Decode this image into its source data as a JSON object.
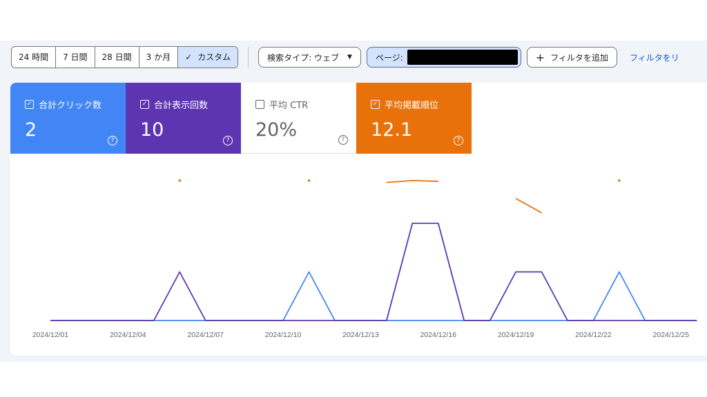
{
  "toolbar": {
    "ranges": [
      "24 時間",
      "7 日間",
      "28 日間",
      "3 か月",
      "カスタム"
    ],
    "active_range": "カスタム",
    "check_glyph": "✓",
    "search_type": "検索タイプ: ウェブ",
    "page_filter_label": "ページ:",
    "add_filter": "フィルタを追加",
    "reset_link": "フィルタをリ"
  },
  "metrics": [
    {
      "label": "合計クリック数",
      "value": "2",
      "checked": true,
      "color": "#4285f4"
    },
    {
      "label": "合計表示回数",
      "value": "10",
      "checked": true,
      "color": "#5e35b1"
    },
    {
      "label": "平均 CTR",
      "value": "20%",
      "checked": false,
      "color": "#5f6368"
    },
    {
      "label": "平均掲載順位",
      "value": "12.1",
      "checked": true,
      "color": "#e8710a"
    }
  ],
  "chart_data": {
    "type": "line",
    "x": [
      "2024/12/01",
      "2024/12/02",
      "2024/12/03",
      "2024/12/04",
      "2024/12/05",
      "2024/12/06",
      "2024/12/07",
      "2024/12/08",
      "2024/12/09",
      "2024/12/10",
      "2024/12/11",
      "2024/12/12",
      "2024/12/13",
      "2024/12/14",
      "2024/12/15",
      "2024/12/16",
      "2024/12/17",
      "2024/12/18",
      "2024/12/19",
      "2024/12/20",
      "2024/12/21",
      "2024/12/22",
      "2024/12/23",
      "2024/12/24",
      "2024/12/25",
      "2024/12/26"
    ],
    "x_tick_labels": [
      "2024/12/01",
      "2024/12/04",
      "2024/12/07",
      "2024/12/10",
      "2024/12/13",
      "2024/12/16",
      "2024/12/19",
      "2024/12/22",
      "2024/12/25"
    ],
    "series": [
      {
        "metric": "clicks",
        "color": "#4285f4",
        "values": [
          0,
          0,
          0,
          0,
          0,
          0,
          0,
          0,
          0,
          0,
          1,
          0,
          0,
          0,
          0,
          0,
          0,
          0,
          0,
          0,
          0,
          0,
          1,
          0,
          0,
          0
        ]
      },
      {
        "metric": "impressions",
        "color": "#5e35b1",
        "values": [
          0,
          0,
          0,
          0,
          0,
          1,
          0,
          0,
          0,
          0,
          0,
          0,
          0,
          0,
          2,
          2,
          0,
          0,
          1,
          1,
          0,
          0,
          0,
          0,
          0,
          0
        ]
      },
      {
        "metric": "position",
        "color": "#e8710a",
        "values": [
          null,
          null,
          null,
          null,
          null,
          11,
          null,
          null,
          null,
          null,
          11,
          null,
          null,
          11.5,
          11,
          11.2,
          null,
          null,
          16,
          20,
          null,
          null,
          11,
          null,
          null,
          null
        ]
      }
    ],
    "grid": false,
    "legend": "none"
  }
}
